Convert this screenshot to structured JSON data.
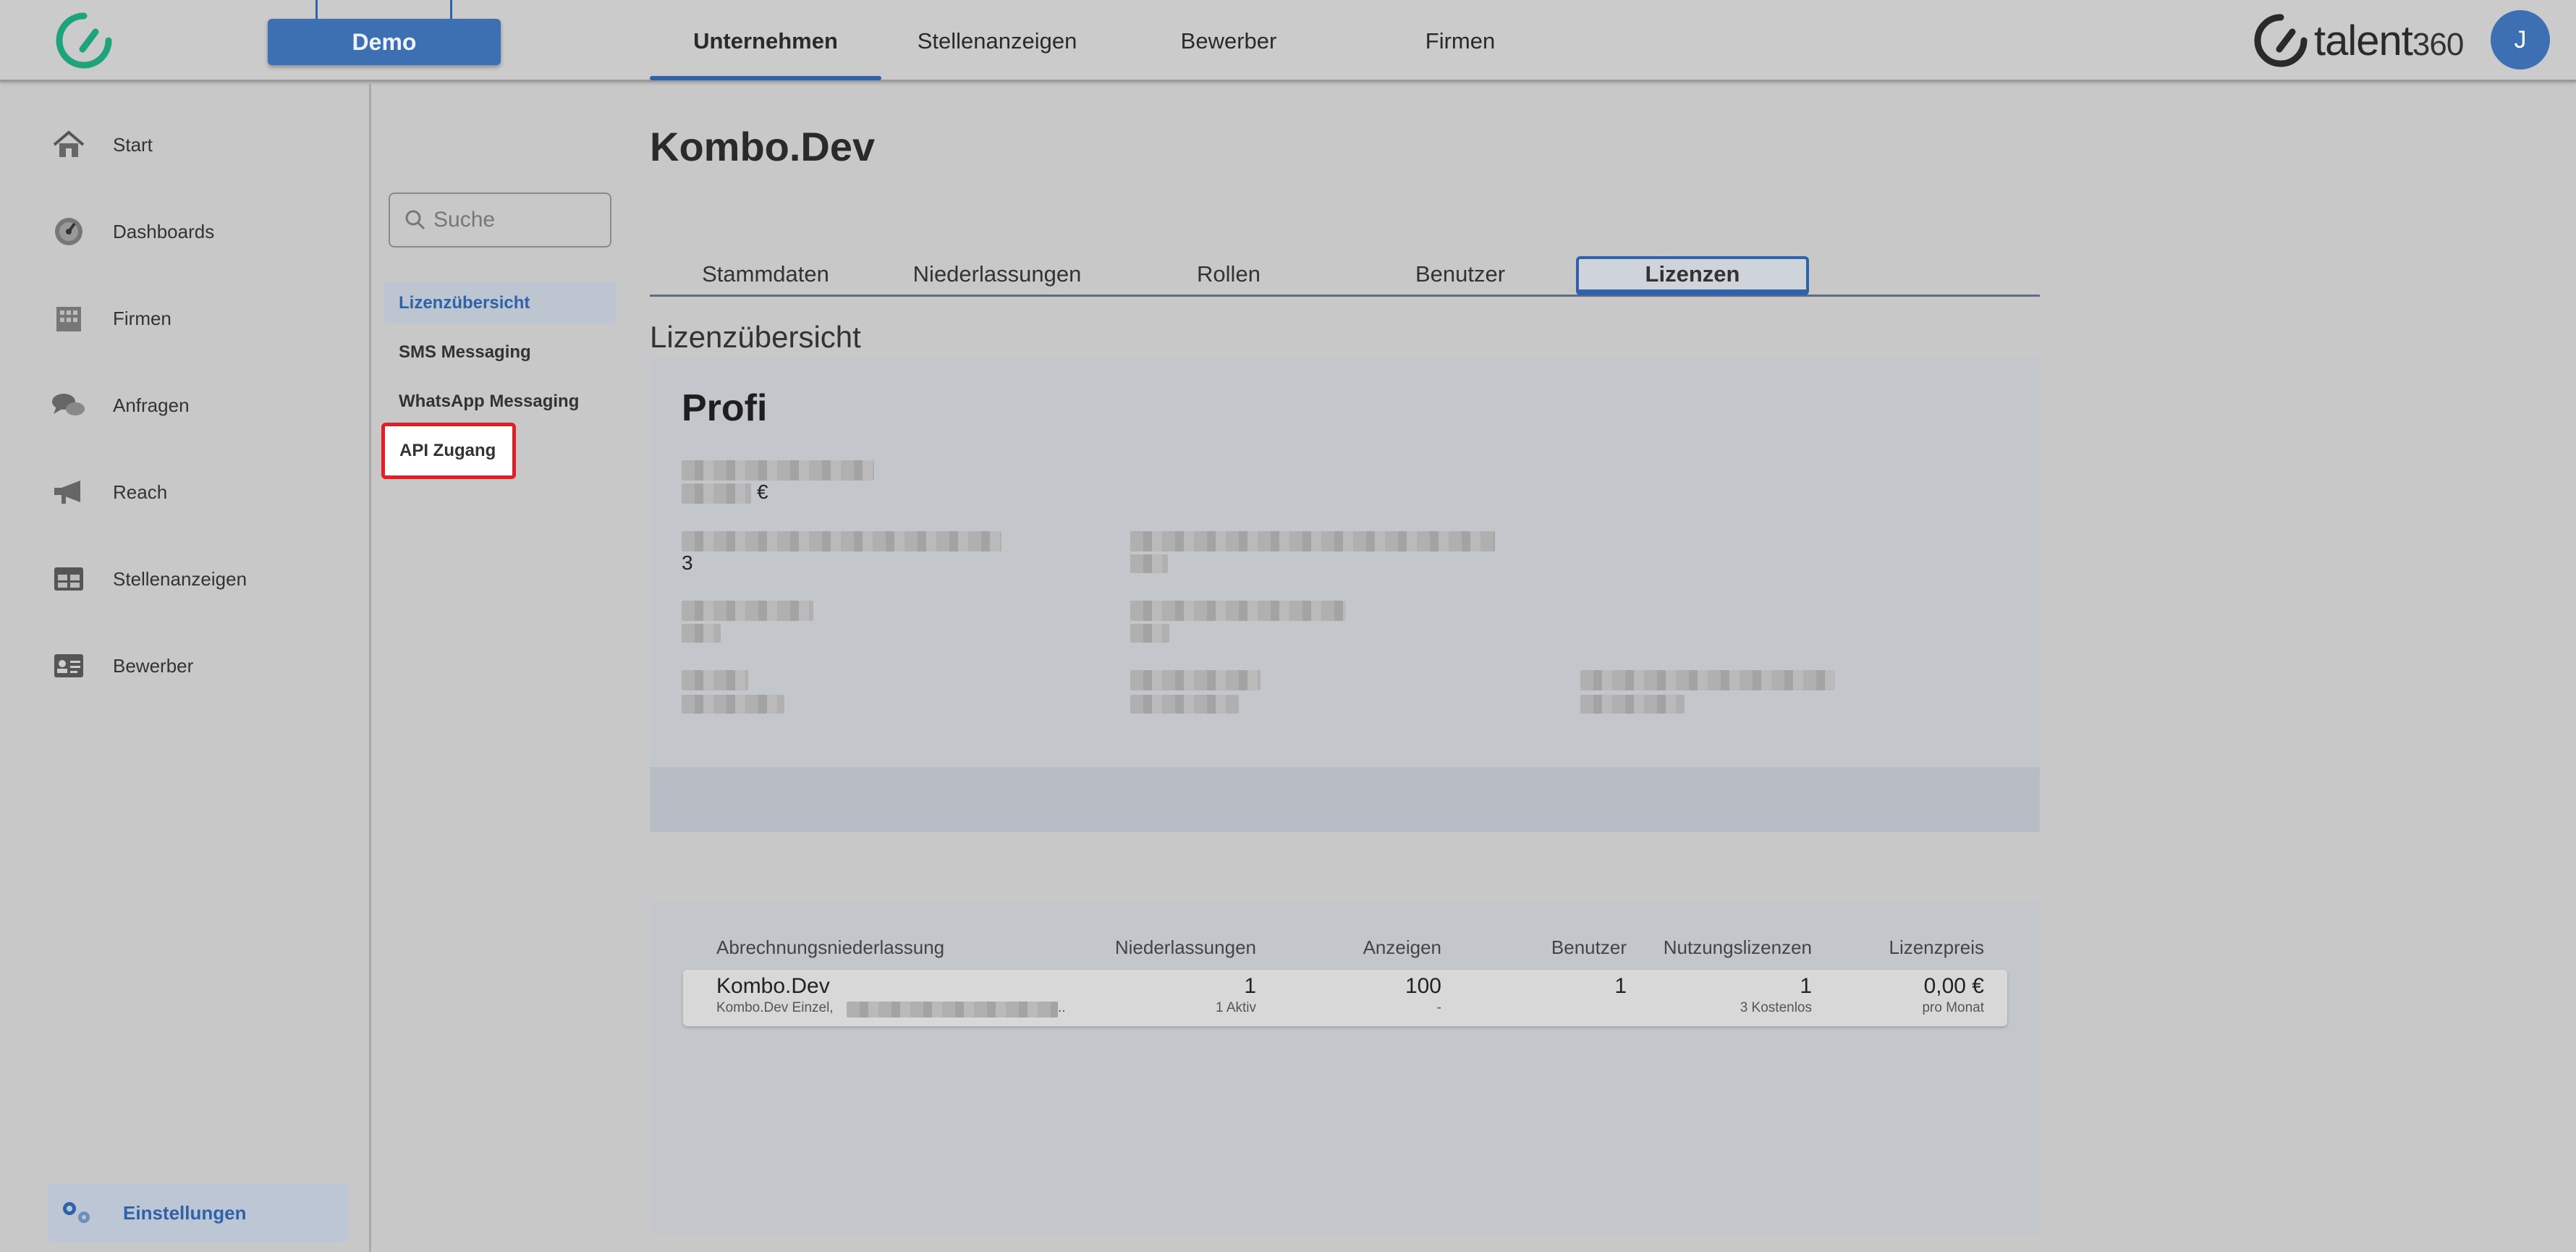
{
  "header": {
    "demo_label": "Demo",
    "nav": [
      {
        "label": "Unternehmen",
        "active": true
      },
      {
        "label": "Stellenanzeigen",
        "active": false
      },
      {
        "label": "Bewerber",
        "active": false
      },
      {
        "label": "Firmen",
        "active": false
      }
    ],
    "brand_word": "talent",
    "brand_number": "360",
    "avatar_initial": "J"
  },
  "sidebar": {
    "items": [
      {
        "label": "Start",
        "icon": "home-icon"
      },
      {
        "label": "Dashboards",
        "icon": "gauge-icon"
      },
      {
        "label": "Firmen",
        "icon": "building-icon"
      },
      {
        "label": "Anfragen",
        "icon": "chat-icon"
      },
      {
        "label": "Reach",
        "icon": "megaphone-icon"
      },
      {
        "label": "Stellenanzeigen",
        "icon": "grid-icon"
      },
      {
        "label": "Bewerber",
        "icon": "id-card-icon"
      }
    ],
    "settings_label": "Einstellungen"
  },
  "subnav": {
    "search_placeholder": "Suche",
    "items": [
      {
        "label": "Lizenzübersicht",
        "active": true
      },
      {
        "label": "SMS Messaging",
        "active": false
      },
      {
        "label": "WhatsApp Messaging",
        "active": false
      },
      {
        "label": "API Zugang",
        "active": false,
        "highlighted": true
      }
    ]
  },
  "main": {
    "company_title": "Kombo.Dev",
    "tabs": [
      {
        "label": "Stammdaten",
        "active": false
      },
      {
        "label": "Niederlassungen",
        "active": false
      },
      {
        "label": "Rollen",
        "active": false
      },
      {
        "label": "Benutzer",
        "active": false
      },
      {
        "label": "Lizenzen",
        "active": true
      }
    ],
    "section_title": "Lizenzübersicht",
    "plan_name": "Profi",
    "price_currency": "€",
    "count_value": "3"
  },
  "table": {
    "headers": [
      "Abrechnungsniederlassung",
      "Niederlassungen",
      "Anzeigen",
      "Benutzer",
      "Nutzungslizenzen",
      "Lizenzpreis"
    ],
    "rows": [
      {
        "name": "Kombo.Dev",
        "name_sub": "Kombo.Dev Einzel,",
        "name_sub_tail": "..",
        "niederlassungen": "1",
        "niederlassungen_sub": "1 Aktiv",
        "anzeigen": "100",
        "anzeigen_sub": "-",
        "benutzer": "1",
        "nutzungslizenzen": "1",
        "nutzungslizenzen_sub": "3 Kostenlos",
        "preis": "0,00 €",
        "preis_sub": "pro Monat"
      }
    ]
  },
  "colors": {
    "accent": "#3d70b2",
    "highlight_border": "#e01f26",
    "logo_green": "#1fa37a"
  }
}
